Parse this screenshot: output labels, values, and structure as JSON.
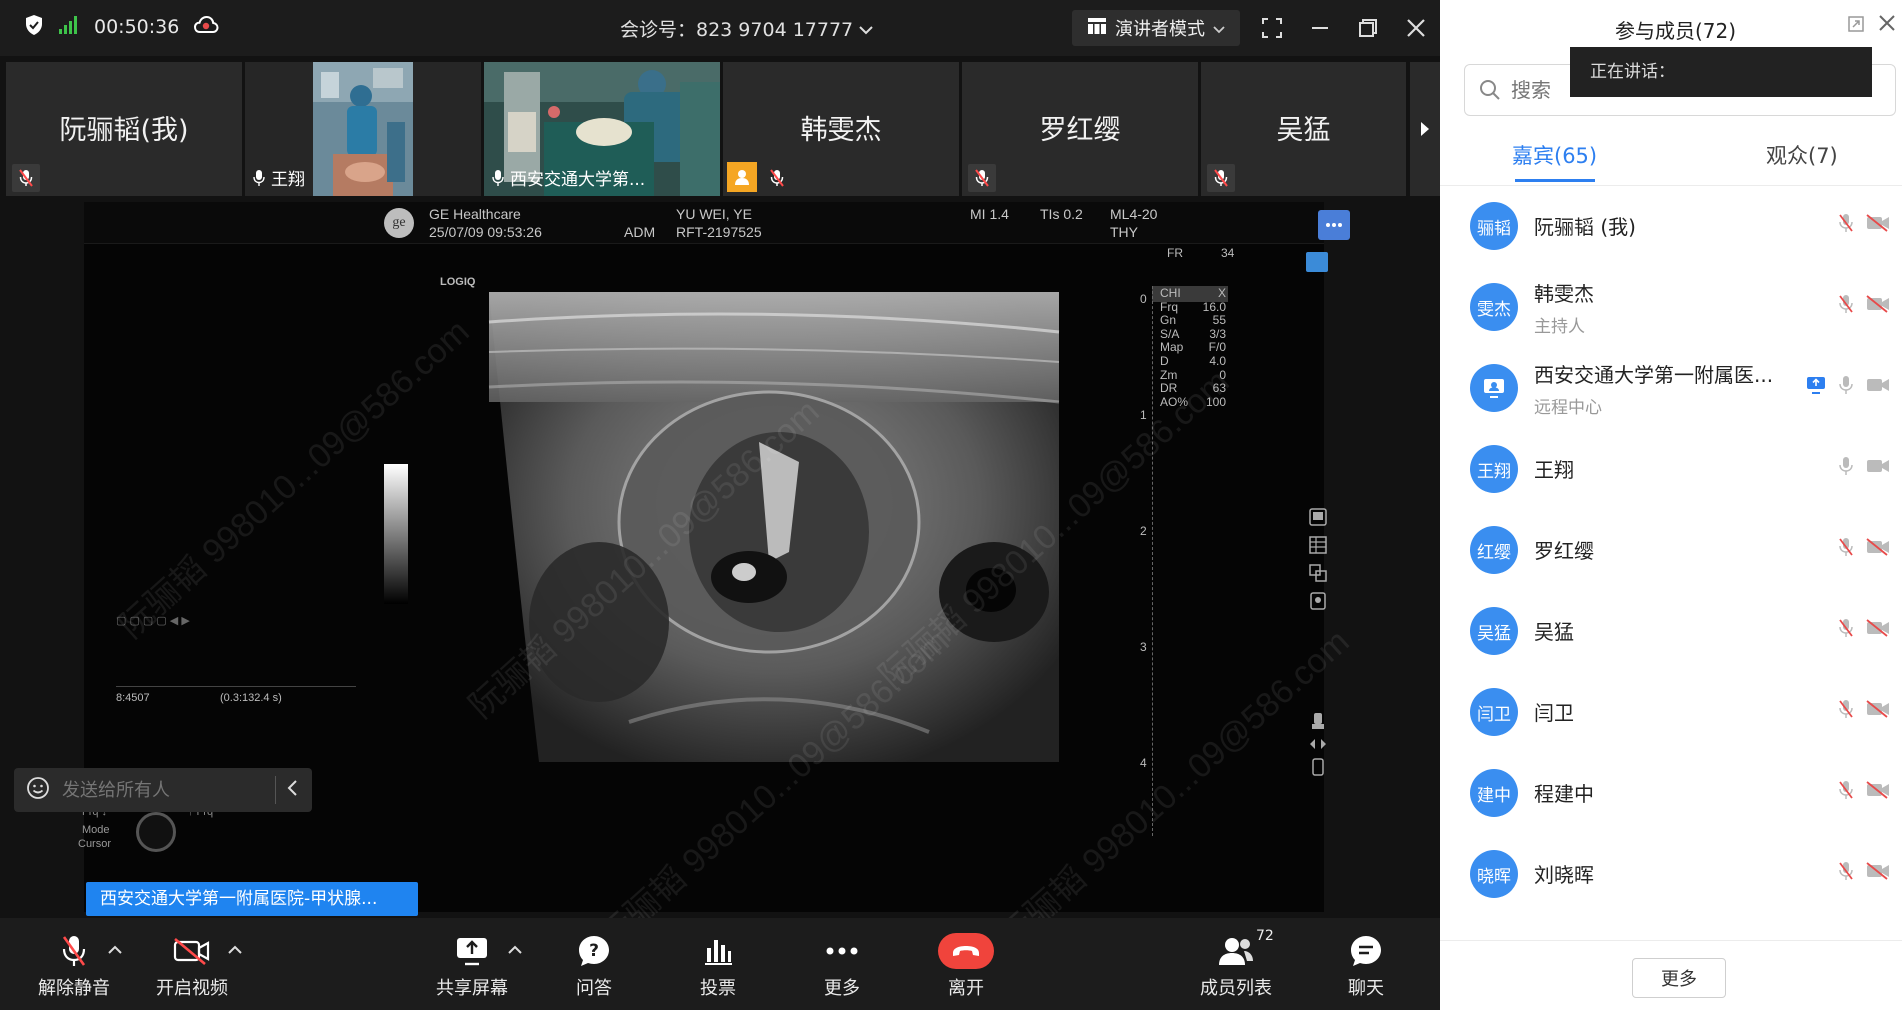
{
  "titlebar": {
    "time": "00:50:36",
    "meeting_id_label": "会诊号：823 9704 17777",
    "presenter_mode": "演讲者模式"
  },
  "video_strip": {
    "tiles": [
      {
        "name": "阮骊韬(我)"
      },
      {
        "label": "王翔"
      },
      {
        "label": "西安交通大学第..."
      },
      {
        "name": "韩雯杰"
      },
      {
        "name": "罗红缨"
      },
      {
        "name": "吴猛"
      }
    ]
  },
  "ultrasound": {
    "vendor": "GE Healthcare",
    "datetime": "25/07/09 09:53:26",
    "operator": "ADM",
    "patient": "YU  WEI, YE",
    "ref": "RFT-2197525",
    "mi": "MI 1.4",
    "tis": "TIs 0.2",
    "probe": "ML4-20",
    "preset": "THY",
    "brand": "LOGIQ",
    "fr_label": "FR",
    "fr_value": "34",
    "params": [
      {
        "k": "CHI",
        "v": "X"
      },
      {
        "k": "Frq",
        "v": "16.0"
      },
      {
        "k": "Gn",
        "v": "55"
      },
      {
        "k": "S/A",
        "v": "3/3"
      },
      {
        "k": "Map",
        "v": "F/0"
      },
      {
        "k": "D",
        "v": "4.0"
      },
      {
        "k": "Zm",
        "v": "0"
      },
      {
        "k": "DR",
        "v": "63"
      },
      {
        "k": "AO%",
        "v": "100"
      }
    ],
    "depth_ticks": [
      "0",
      "1",
      "2",
      "3",
      "4"
    ],
    "cine_counter": "8:4507",
    "cine_time": "(0.3:132.4 s)",
    "frq_down": "Frq ↓",
    "frq_up": "↑ Frq",
    "mode_label": "Mode",
    "cursor_label": "Cursor",
    "watermark": "阮骊韬 998010...09@586.com"
  },
  "chat": {
    "placeholder": "发送给所有人"
  },
  "share_tag": "西安交通大学第一附属医院-甲状腺...",
  "toolbar": {
    "unmute": "解除静音",
    "start_video": "开启视频",
    "share_screen": "共享屏幕",
    "qa": "问答",
    "vote": "投票",
    "more": "更多",
    "leave": "离开",
    "members": "成员列表",
    "members_count": "72",
    "chat": "聊天"
  },
  "panel": {
    "title": "参与成员(72)",
    "speaking": "正在讲话：",
    "search_placeholder": "搜索",
    "tab_guests": "嘉宾(65)",
    "tab_audience": "观众(7)",
    "participants": [
      {
        "avatar": "骊韬",
        "name": "阮骊韬 (我)",
        "role": ""
      },
      {
        "avatar": "雯杰",
        "name": "韩雯杰",
        "role": "主持人"
      },
      {
        "avatar": "",
        "name": "西安交通大学第一附属医...",
        "role": "远程中心"
      },
      {
        "avatar": "王翔",
        "name": "王翔",
        "role": ""
      },
      {
        "avatar": "红缨",
        "name": "罗红缨",
        "role": ""
      },
      {
        "avatar": "吴猛",
        "name": "吴猛",
        "role": ""
      },
      {
        "avatar": "闫卫",
        "name": "闫卫",
        "role": ""
      },
      {
        "avatar": "建中",
        "name": "程建中",
        "role": ""
      },
      {
        "avatar": "晓晖",
        "name": "刘晓晖",
        "role": ""
      }
    ],
    "more_button": "更多"
  }
}
